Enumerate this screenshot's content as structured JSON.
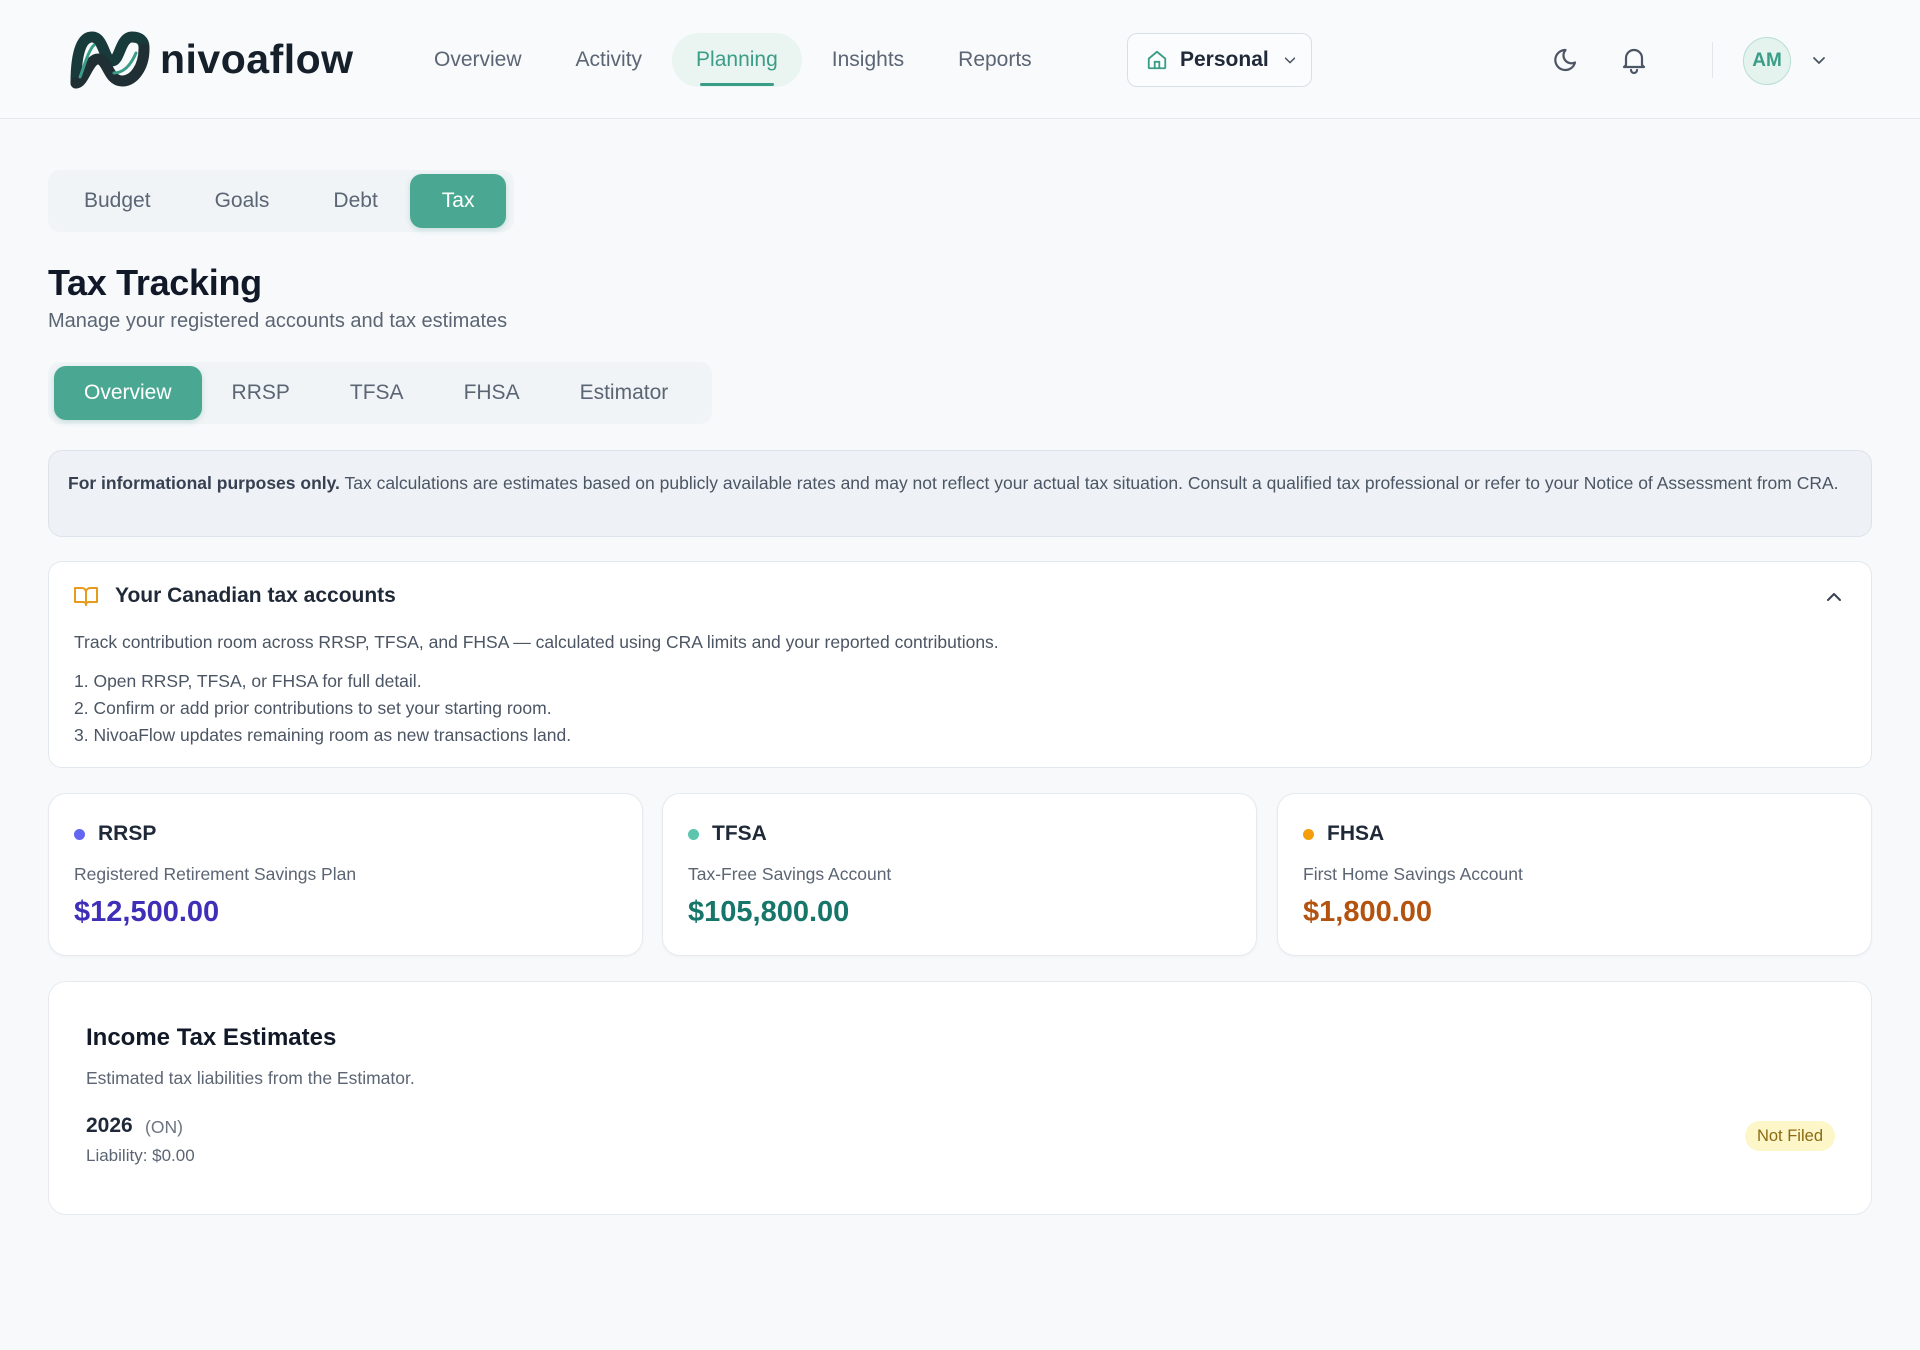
{
  "brand": {
    "name": "nivoaflow"
  },
  "nav": {
    "items": [
      {
        "label": "Overview"
      },
      {
        "label": "Activity"
      },
      {
        "label": "Planning"
      },
      {
        "label": "Insights"
      },
      {
        "label": "Reports"
      }
    ],
    "active": "Planning"
  },
  "workspace": {
    "selected": "Personal"
  },
  "user": {
    "initials": "AM"
  },
  "planning_tabs": {
    "items": [
      {
        "label": "Budget"
      },
      {
        "label": "Goals"
      },
      {
        "label": "Debt"
      },
      {
        "label": "Tax"
      }
    ],
    "active": "Tax"
  },
  "page": {
    "title": "Tax Tracking",
    "subtitle": "Manage your registered accounts and tax estimates"
  },
  "tax_tabs": {
    "items": [
      {
        "label": "Overview"
      },
      {
        "label": "RRSP"
      },
      {
        "label": "TFSA"
      },
      {
        "label": "FHSA"
      },
      {
        "label": "Estimator"
      }
    ],
    "active": "Overview"
  },
  "disclaimer": {
    "bold": "For informational purposes only.",
    "text": "Tax calculations are estimates based on publicly available rates and may not reflect your actual tax situation. Consult a qualified tax professional or refer to your Notice of Assessment from CRA."
  },
  "accounts_info": {
    "title": "Your Canadian tax accounts",
    "description": "Track contribution room across RRSP, TFSA, and FHSA — calculated using CRA limits and your reported contributions.",
    "steps": [
      "1. Open RRSP, TFSA, or FHSA for full detail.",
      "2. Confirm or add prior contributions to set your starting room.",
      "3. NivoaFlow updates remaining room as new transactions land."
    ]
  },
  "accounts": [
    {
      "name": "RRSP",
      "description": "Registered Retirement Savings Plan",
      "amount": "$12,500.00",
      "dot_color": "#6366f1",
      "amount_color": "#3f2fb8"
    },
    {
      "name": "TFSA",
      "description": "Tax-Free Savings Account",
      "amount": "$105,800.00",
      "dot_color": "#5cc5ad",
      "amount_color": "#17766a"
    },
    {
      "name": "FHSA",
      "description": "First Home Savings Account",
      "amount": "$1,800.00",
      "dot_color": "#f59e0b",
      "amount_color": "#b4530f"
    }
  ],
  "income_tax": {
    "title": "Income Tax Estimates",
    "subtitle": "Estimated tax liabilities from the Estimator.",
    "entries": [
      {
        "year": "2026",
        "province": "(ON)",
        "liability": "Liability: $0.00",
        "status": "Not Filed"
      }
    ]
  },
  "colors": {
    "accent": "#4aa892",
    "accent_text": "#3a9d87",
    "badge_bg": "#fdf6c9",
    "badge_text": "#8a6a12"
  },
  "icons": {
    "workspace": "home-icon",
    "theme": "moon-icon",
    "notifications": "bell-icon",
    "accounts_info": "book-open-icon",
    "collapse": "chevron-up-icon",
    "dropdown": "chevron-down-icon"
  }
}
